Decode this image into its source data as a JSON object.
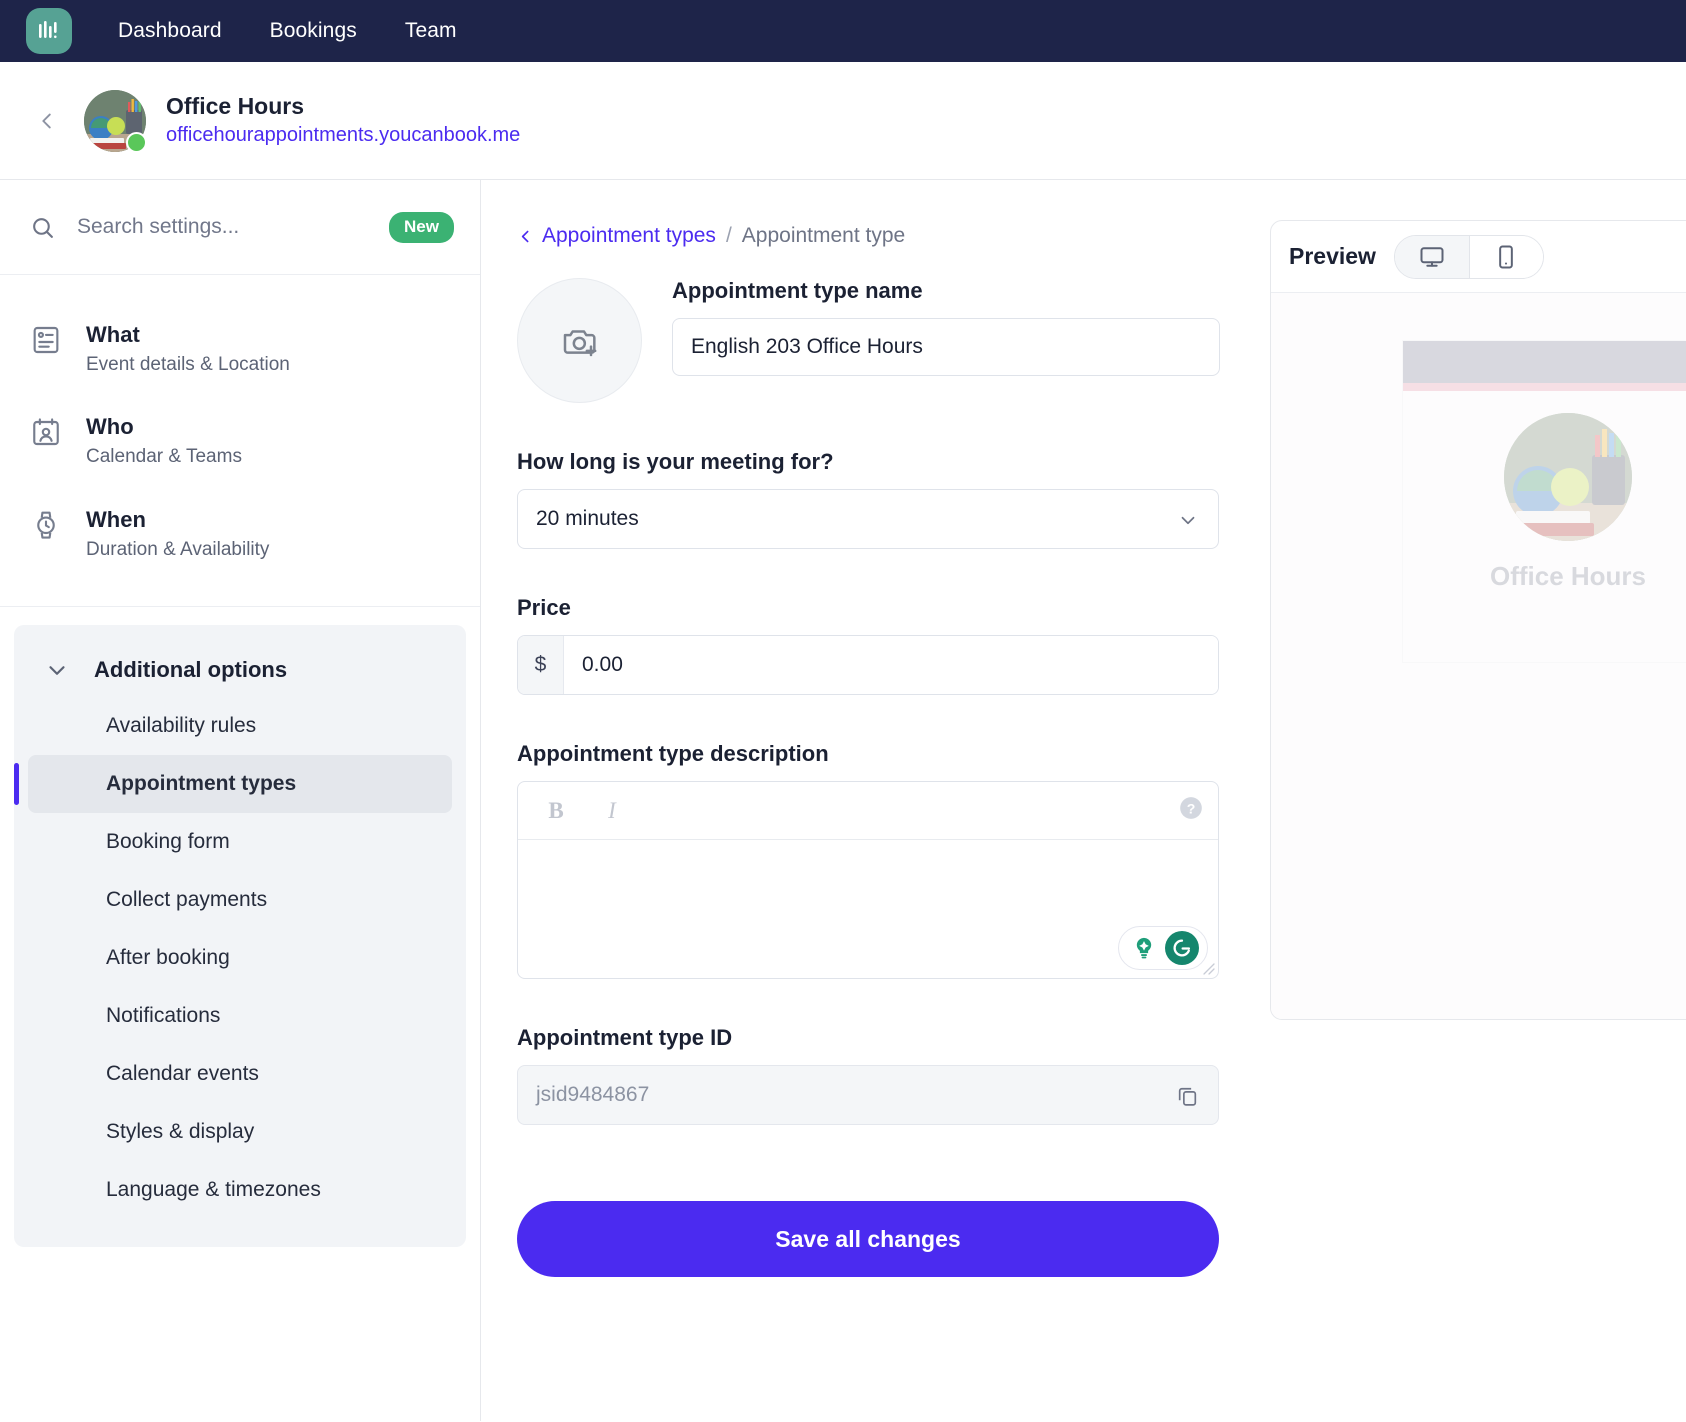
{
  "topnav": {
    "logo_icon": "youcanbookme-bars-logo",
    "links": [
      {
        "label": "Dashboard"
      },
      {
        "label": "Bookings"
      },
      {
        "label": "Team"
      }
    ]
  },
  "account": {
    "back_icon": "chevron-left-icon",
    "avatar_icon": "account-avatar",
    "status_icon": "online-status-dot",
    "name": "Office Hours",
    "url": "officehourappointments.youcanbook.me"
  },
  "sidebar": {
    "search": {
      "icon": "search-icon",
      "placeholder": "Search settings...",
      "value": "",
      "badge": "New"
    },
    "main_items": [
      {
        "icon": "event-details-icon",
        "title": "What",
        "subtitle": "Event details & Location"
      },
      {
        "icon": "calendar-person-icon",
        "title": "Who",
        "subtitle": "Calendar & Teams"
      },
      {
        "icon": "watch-clock-icon",
        "title": "When",
        "subtitle": "Duration & Availability"
      }
    ],
    "additional": {
      "chevron_icon": "chevron-down-icon",
      "title": "Additional options",
      "items": [
        {
          "label": "Availability rules",
          "active": false
        },
        {
          "label": "Appointment types",
          "active": true
        },
        {
          "label": "Booking form",
          "active": false
        },
        {
          "label": "Collect payments",
          "active": false
        },
        {
          "label": "After booking",
          "active": false
        },
        {
          "label": "Notifications",
          "active": false
        },
        {
          "label": "Calendar events",
          "active": false
        },
        {
          "label": "Styles & display",
          "active": false
        },
        {
          "label": "Language & timezones",
          "active": false
        }
      ]
    }
  },
  "main": {
    "breadcrumb": {
      "back_icon": "chevron-left-icon",
      "parent": "Appointment types",
      "separator": "/",
      "current": "Appointment type"
    },
    "avatar_upload": {
      "icon": "camera-plus-icon"
    },
    "name_field": {
      "label": "Appointment type name",
      "value": "English 203 Office Hours",
      "placeholder": ""
    },
    "duration_field": {
      "label": "How long is your meeting for?",
      "value": "20 minutes",
      "chevron_icon": "chevron-down-icon"
    },
    "price_field": {
      "label": "Price",
      "currency_symbol": "$",
      "value": "0.00"
    },
    "description_field": {
      "label": "Appointment type description",
      "value": "",
      "toolbar": {
        "bold": "B",
        "italic": "I",
        "help_icon": "help-question-icon"
      },
      "assistant": {
        "bulb_icon": "lightbulb-icon",
        "grammarly_icon": "grammarly-g-icon",
        "grammarly_letter": "G"
      },
      "resize_icon": "resize-grip-icon"
    },
    "id_field": {
      "label": "Appointment type ID",
      "value": "jsid9484867",
      "copy_icon": "copy-icon"
    },
    "save_label": "Save all changes"
  },
  "preview": {
    "title": "Preview",
    "desktop_icon": "desktop-monitor-icon",
    "mobile_icon": "mobile-phone-icon",
    "active_device": "desktop",
    "page": {
      "profile_name": "Office Hours"
    }
  },
  "colors": {
    "nav_background": "#1e2449",
    "logo_teal": "#56a294",
    "accent_purple": "#4b2bf0",
    "badge_green": "#3bb273",
    "status_green": "#5ac75a",
    "sidebar_panel": "#f2f4f7",
    "active_item": "#e4e7ec",
    "grammarly_green": "#15866d",
    "preview_banner": "#8b90a3",
    "preview_stripe": "#eaa3b4"
  }
}
